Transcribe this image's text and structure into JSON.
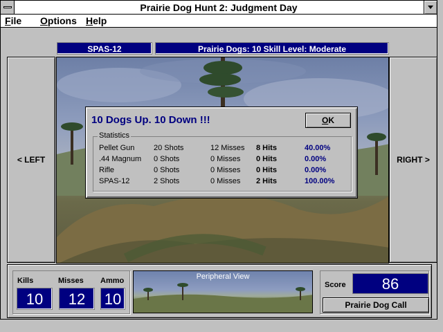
{
  "window": {
    "title": "Prairie Dog Hunt 2: Judgment Day"
  },
  "menu": {
    "file": {
      "hotkey": "F",
      "rest": "ile"
    },
    "options": {
      "hotkey": "O",
      "rest": "ptions"
    },
    "help": {
      "hotkey": "H",
      "rest": "elp"
    }
  },
  "status": {
    "weapon": "SPAS-12",
    "info": "Prairie Dogs: 10   Skill Level: Moderate"
  },
  "nav": {
    "left": "< LEFT",
    "right": "RIGHT >"
  },
  "dialog": {
    "title": "10 Dogs Up. 10 Down !!!",
    "ok_hotkey": "O",
    "ok_rest": "K",
    "stats_label": "Statistics",
    "rows": [
      {
        "weapon": "Pellet Gun",
        "shots": "20 Shots",
        "misses": "12 Misses",
        "hits": "8 Hits",
        "pct": "40.00%"
      },
      {
        "weapon": ".44 Magnum",
        "shots": "0 Shots",
        "misses": "0 Misses",
        "hits": "0 Hits",
        "pct": "0.00%"
      },
      {
        "weapon": "Rifle",
        "shots": "0 Shots",
        "misses": "0 Misses",
        "hits": "0 Hits",
        "pct": "0.00%"
      },
      {
        "weapon": "SPAS-12",
        "shots": "2 Shots",
        "misses": "0 Misses",
        "hits": "2 Hits",
        "pct": "100.00%"
      }
    ]
  },
  "counters": {
    "kills_label": "Kills",
    "kills": "10",
    "misses_label": "Misses",
    "misses": "12",
    "ammo_label": "Ammo",
    "ammo": "10"
  },
  "peripheral": {
    "label": "Peripheral View"
  },
  "score": {
    "label": "Score",
    "value": "86",
    "call_button": "Prairie Dog Call"
  },
  "colors": {
    "panel": "#c0c0c0",
    "display_blue": "#000080",
    "percent_blue": "#000080"
  }
}
